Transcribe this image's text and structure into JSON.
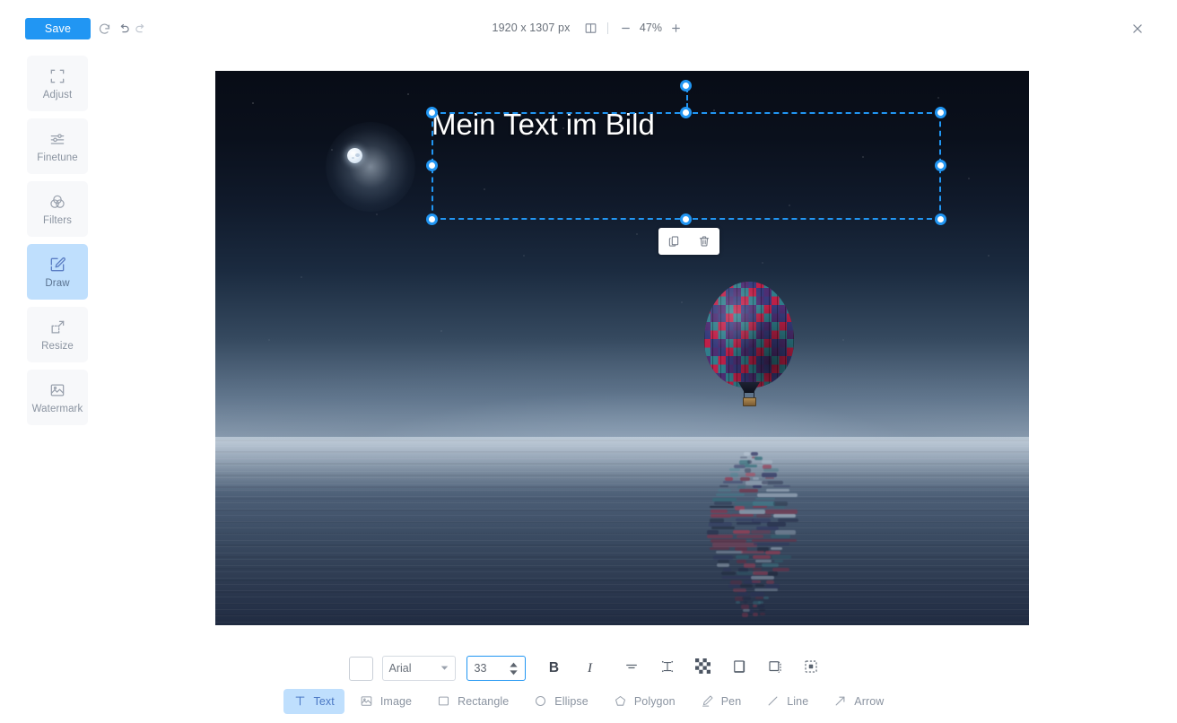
{
  "topbar": {
    "save_label": "Save",
    "revert_icon": "revert-icon",
    "undo_icon": "undo-icon",
    "redo_icon": "redo-icon",
    "image_dimensions": "1920 x 1307 px",
    "compare_icon": "compare-split-icon",
    "zoom_out_icon": "minus-icon",
    "zoom_level": "47%",
    "zoom_in_icon": "plus-icon",
    "close_icon": "close-icon"
  },
  "sidebar": {
    "items": [
      {
        "label": "Adjust",
        "icon": "crop-icon",
        "active": false
      },
      {
        "label": "Finetune",
        "icon": "sliders-icon",
        "active": false
      },
      {
        "label": "Filters",
        "icon": "filters-icon",
        "active": false
      },
      {
        "label": "Draw",
        "icon": "pencil-icon",
        "active": true
      },
      {
        "label": "Resize",
        "icon": "resize-icon",
        "active": false
      },
      {
        "label": "Watermark",
        "icon": "watermark-icon",
        "active": false
      }
    ]
  },
  "canvas": {
    "text_object": {
      "value": "Mein Text im Bild",
      "color": "#ffffff",
      "font_size": 33,
      "font_family": "Arial"
    },
    "object_menu": {
      "duplicate_icon": "duplicate-icon",
      "delete_icon": "trash-icon"
    },
    "selection": {
      "handles": [
        "top-left",
        "top-center",
        "top-right",
        "middle-left",
        "middle-right",
        "bottom-left",
        "bottom-center",
        "bottom-right"
      ],
      "rotate_handle": "rotate-handle"
    }
  },
  "text_options": {
    "color_swatch": "#ffffff",
    "font_family": "Arial",
    "font_family_caret_icon": "chevron-down-icon",
    "font_size": "33",
    "stepper_icon": "stepper-arrows-icon",
    "bold_label": "B",
    "italic_label": "I",
    "buttons": [
      {
        "name": "text-align-button",
        "icon": "text-align-icon"
      },
      {
        "name": "line-height-button",
        "icon": "line-height-icon"
      },
      {
        "name": "opacity-button",
        "icon": "checkerboard-icon"
      },
      {
        "name": "shadow-button",
        "icon": "shadow-icon"
      },
      {
        "name": "stroke-button",
        "icon": "stroke-icon"
      },
      {
        "name": "position-button",
        "icon": "position-icon"
      }
    ]
  },
  "tools": [
    {
      "label": "Text",
      "icon": "text-icon",
      "active": true
    },
    {
      "label": "Image",
      "icon": "image-icon",
      "active": false
    },
    {
      "label": "Rectangle",
      "icon": "rectangle-icon",
      "active": false
    },
    {
      "label": "Ellipse",
      "icon": "ellipse-icon",
      "active": false
    },
    {
      "label": "Polygon",
      "icon": "polygon-icon",
      "active": false
    },
    {
      "label": "Pen",
      "icon": "pen-icon",
      "active": false
    },
    {
      "label": "Line",
      "icon": "line-icon",
      "active": false
    },
    {
      "label": "Arrow",
      "icon": "arrow-icon",
      "active": false
    }
  ],
  "colors": {
    "accent": "#2196f3",
    "accent_soft": "#bfdffd",
    "tab_bg": "#f7f8fa",
    "muted_text": "#8a93a0"
  }
}
